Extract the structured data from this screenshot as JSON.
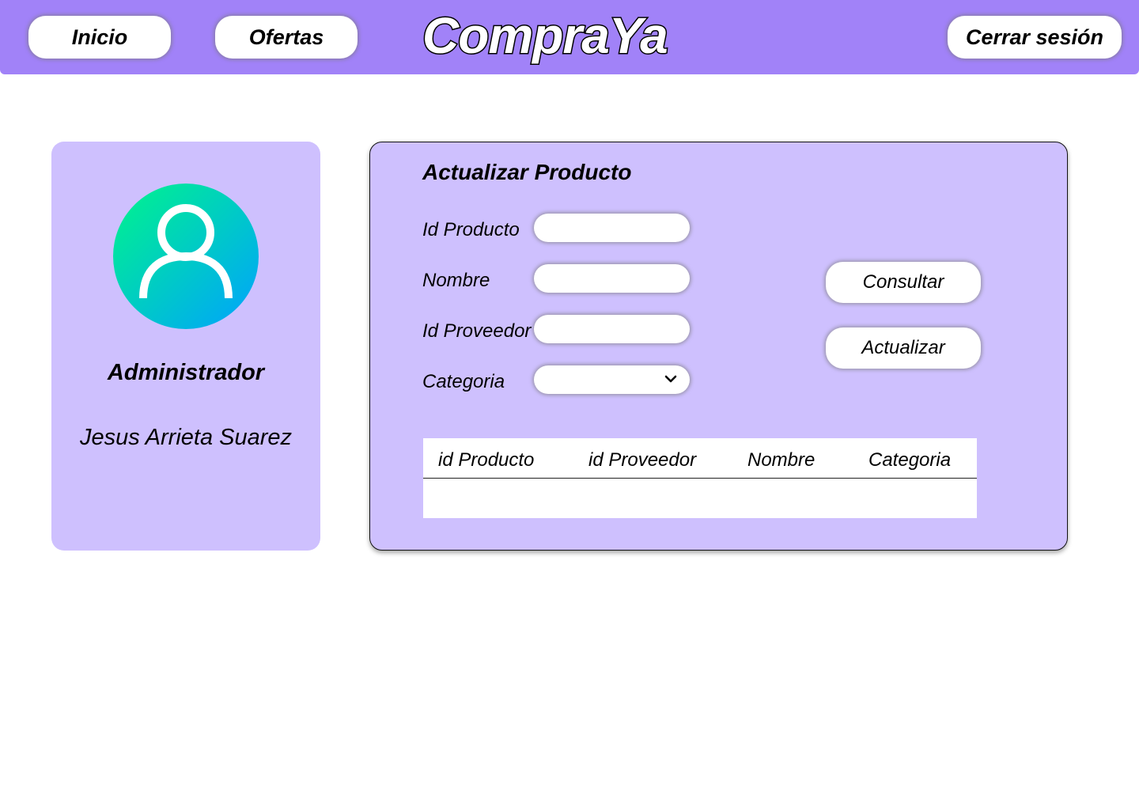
{
  "header": {
    "nav": [
      {
        "label": "Inicio"
      },
      {
        "label": "Ofertas"
      }
    ],
    "logo_text": "CompraYa",
    "logout_label": "Cerrar sesión"
  },
  "profile": {
    "avatar_icon": "user-icon",
    "role": "Administrador",
    "name": "Jesus Arrieta Suarez"
  },
  "form": {
    "title": "Actualizar Producto",
    "fields": [
      {
        "label": "Id Producto",
        "value": ""
      },
      {
        "label": "Nombre",
        "value": ""
      },
      {
        "label": "Id Proveedor",
        "value": ""
      },
      {
        "label": "Categoria",
        "value": ""
      }
    ],
    "buttons": {
      "consult_label": "Consultar",
      "update_label": "Actualizar"
    },
    "table": {
      "columns": [
        "id Producto",
        "id Proveedor",
        "Nombre",
        "Categoria"
      ],
      "rows": []
    }
  },
  "colors": {
    "header_bg": "#a182f8",
    "card_bg": "#cec0fe",
    "avatar_gradient_start": "#00f58a",
    "avatar_gradient_end": "#00a2ff"
  }
}
